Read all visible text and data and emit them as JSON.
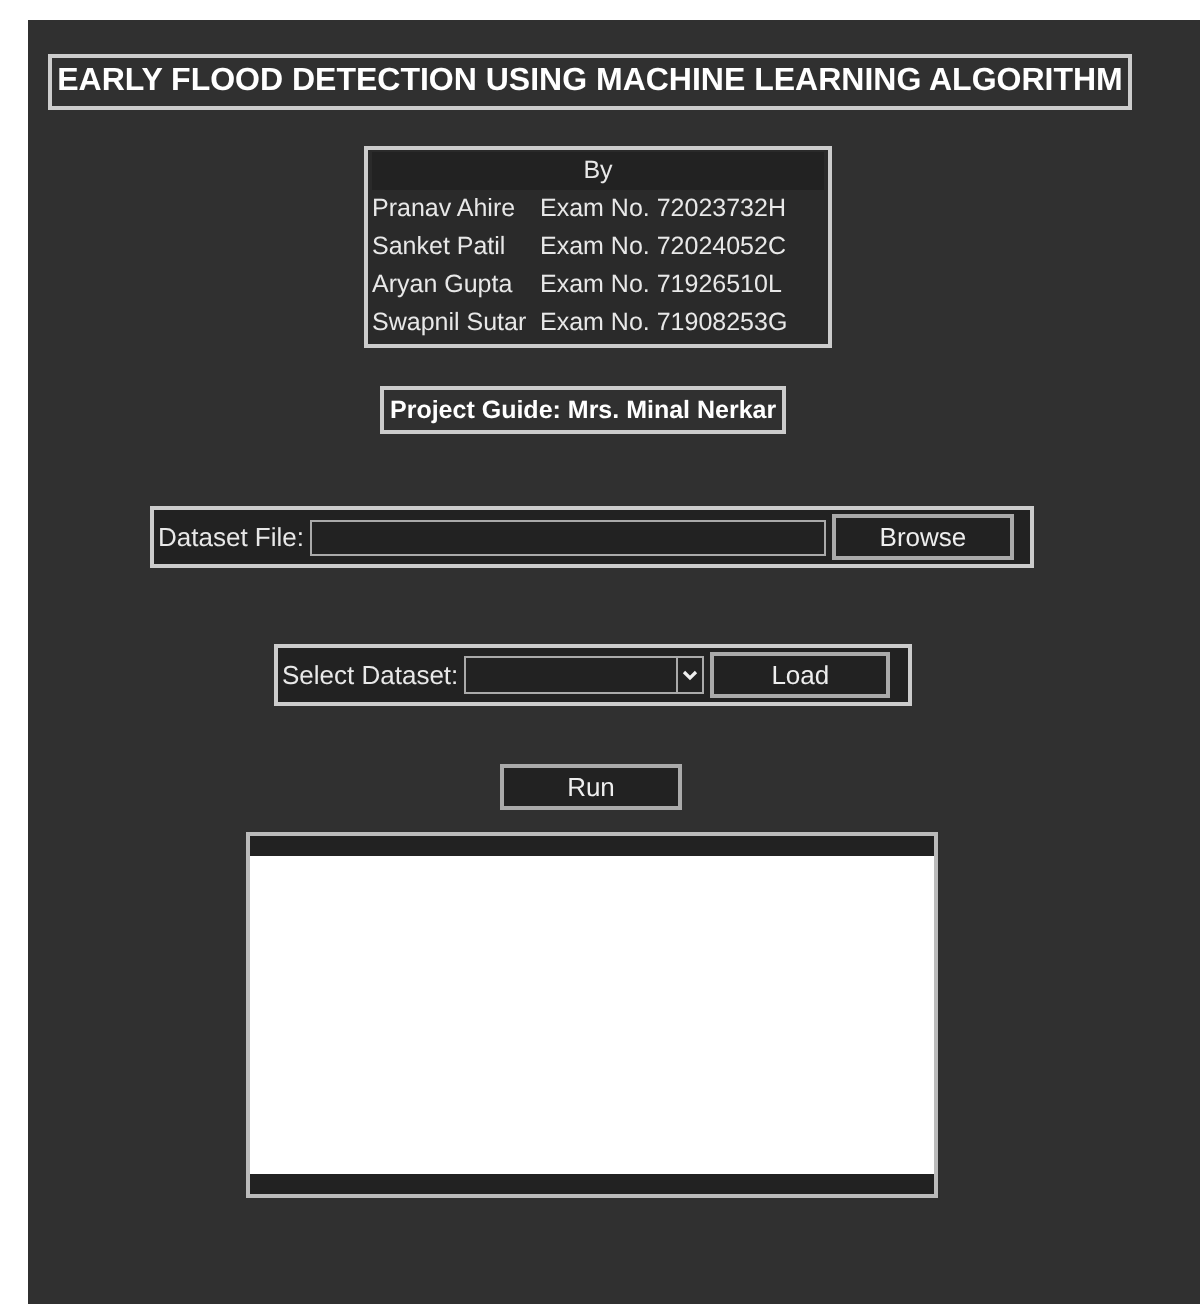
{
  "title": "EARLY FLOOD DETECTION USING MACHINE LEARNING ALGORITHM",
  "authors_heading": "By",
  "authors": [
    {
      "name": "Pranav Ahire",
      "exam": "Exam No. 72023732H"
    },
    {
      "name": "Sanket Patil",
      "exam": "Exam No. 72024052C"
    },
    {
      "name": "Aryan Gupta",
      "exam": "Exam No. 71926510L"
    },
    {
      "name": "Swapnil Sutar",
      "exam": "Exam No. 71908253G"
    }
  ],
  "guide": "Project Guide: Mrs. Minal Nerkar",
  "dataset_file": {
    "label": "Dataset File:",
    "button": "Browse"
  },
  "select_dataset": {
    "label": "Select Dataset:",
    "button": "Load"
  },
  "run_button": "Run"
}
